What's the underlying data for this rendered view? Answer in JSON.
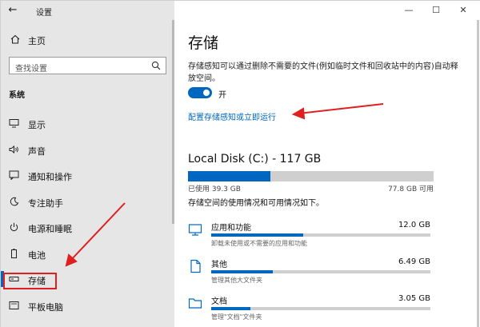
{
  "window": {
    "title": "设置"
  },
  "sidebar": {
    "home_label": "主页",
    "search_placeholder": "查找设置",
    "section_title": "系统",
    "items": [
      {
        "label": "显示",
        "icon": "monitor-icon"
      },
      {
        "label": "声音",
        "icon": "speaker-icon"
      },
      {
        "label": "通知和操作",
        "icon": "notification-icon"
      },
      {
        "label": "专注助手",
        "icon": "moon-icon"
      },
      {
        "label": "电源和睡眠",
        "icon": "power-icon"
      },
      {
        "label": "电池",
        "icon": "battery-icon"
      },
      {
        "label": "存储",
        "icon": "storage-icon",
        "active": true
      },
      {
        "label": "平板电脑",
        "icon": "tablet-icon"
      }
    ]
  },
  "main": {
    "title": "存储",
    "description": "存储感知可以通过删除不需要的文件(例如临时文件和回收站中的内容)自动释放空间。",
    "toggle_label": "开",
    "config_link": "配置存储感知或立即运行",
    "disk": {
      "title": "Local Disk (C:) - 117 GB",
      "used_label": "已使用 39.3 GB",
      "free_label": "77.8 GB 可用",
      "used_fraction": 0.336
    },
    "usage_desc": "存储空间的使用情况和可用情况如下。",
    "categories": [
      {
        "name": "应用和功能",
        "size": "12.0 GB",
        "sub": "卸载未使用或不需要的应用和功能",
        "fraction": 0.42,
        "icon": "apps-icon"
      },
      {
        "name": "其他",
        "size": "6.49 GB",
        "sub": "管理其他大文件夹",
        "fraction": 0.28,
        "icon": "file-icon"
      },
      {
        "name": "文档",
        "size": "3.05 GB",
        "sub": "管理\"文档\"文件夹",
        "fraction": 0.18,
        "icon": "folder-icon"
      }
    ]
  },
  "colors": {
    "accent": "#0067c0",
    "annotation": "#e02020"
  }
}
